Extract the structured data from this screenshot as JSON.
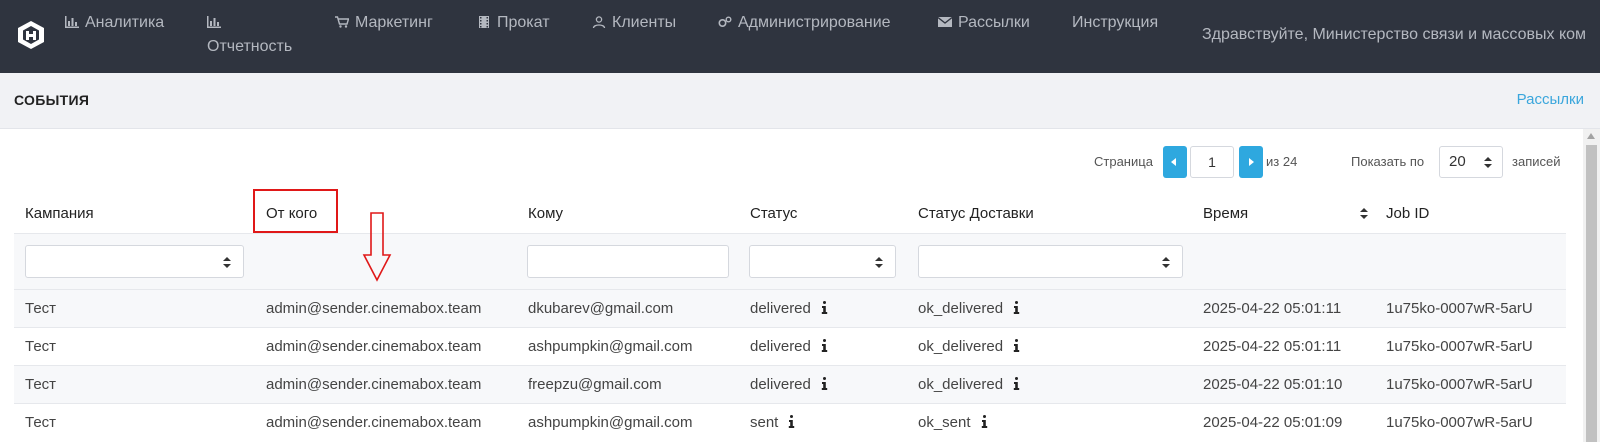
{
  "nav": {
    "items": [
      {
        "label": "Аналитика",
        "icon": "bar-chart-icon"
      },
      {
        "label": "Отчетность",
        "icon": "bar-chart-icon"
      },
      {
        "label": "Маркетинг",
        "icon": "cart-icon"
      },
      {
        "label": "Прокат",
        "icon": "film-icon"
      },
      {
        "label": "Клиенты",
        "icon": "user-icon"
      },
      {
        "label": "Администрирование",
        "icon": "gears-icon"
      },
      {
        "label": "Рассылки",
        "icon": "envelope-icon"
      },
      {
        "label": "Инструкция",
        "icon": ""
      }
    ],
    "greeting": "Здравствуйте, Министерство связи и массовых ком"
  },
  "header": {
    "title": "СОБЫТИЯ",
    "link": "Рассылки"
  },
  "pagination": {
    "page_label": "Страница",
    "current_page": "1",
    "total_label": "из 24",
    "show_label": "Показать по",
    "page_size": "20",
    "records_label": "записей"
  },
  "table": {
    "columns": [
      "Кампания",
      "От кого",
      "Кому",
      "Статус",
      "Статус Доставки",
      "Время",
      "Job ID"
    ],
    "rows": [
      {
        "campaign": "Тест",
        "from": "admin@sender.cinemabox.team",
        "to": "dkubarev@gmail.com",
        "status": "delivered",
        "delivery": "ok_delivered",
        "time": "2025-04-22 05:01:11",
        "job": "1u75ko-0007wR-5arU"
      },
      {
        "campaign": "Тест",
        "from": "admin@sender.cinemabox.team",
        "to": "ashpumpkin@gmail.com",
        "status": "delivered",
        "delivery": "ok_delivered",
        "time": "2025-04-22 05:01:11",
        "job": "1u75ko-0007wR-5arU"
      },
      {
        "campaign": "Тест",
        "from": "admin@sender.cinemabox.team",
        "to": "freepzu@gmail.com",
        "status": "delivered",
        "delivery": "ok_delivered",
        "time": "2025-04-22 05:01:10",
        "job": "1u75ko-0007wR-5arU"
      },
      {
        "campaign": "Тест",
        "from": "admin@sender.cinemabox.team",
        "to": "ashpumpkin@gmail.com",
        "status": "sent",
        "delivery": "ok_sent",
        "time": "2025-04-22 05:01:09",
        "job": "1u75ko-0007wR-5arU"
      }
    ]
  },
  "colors": {
    "navbar_bg": "#2f343f",
    "accent": "#2ea8df",
    "annotation": "#e01818"
  }
}
